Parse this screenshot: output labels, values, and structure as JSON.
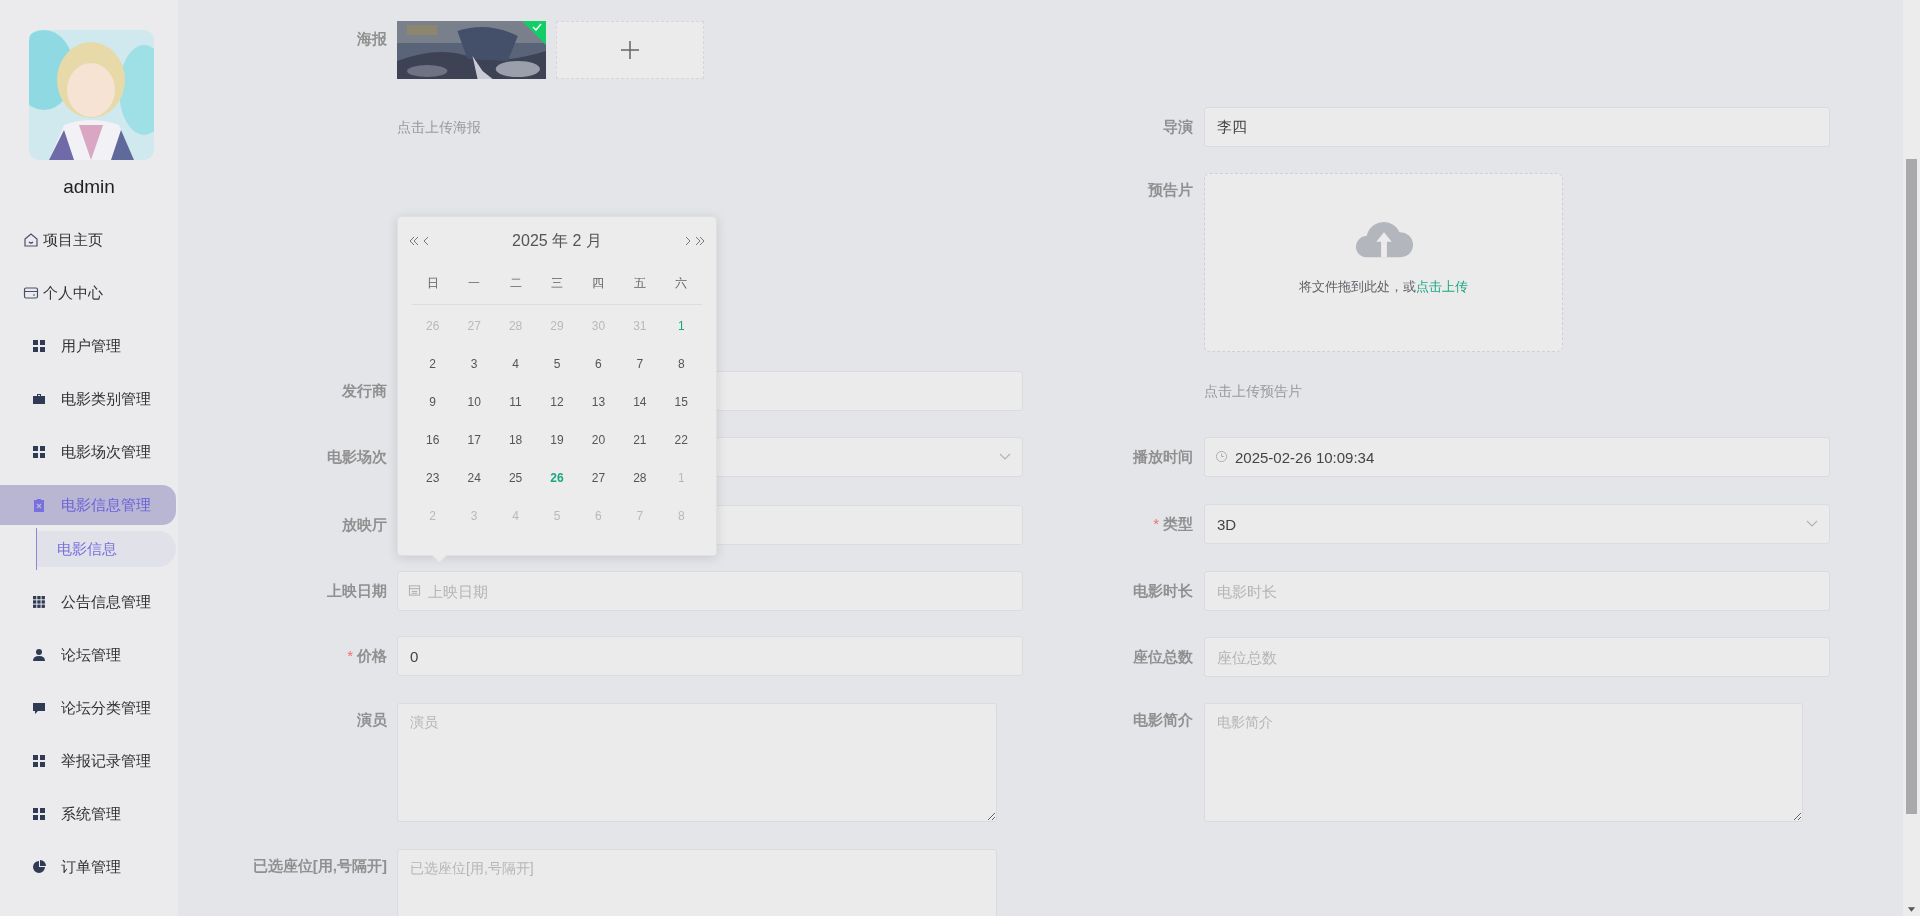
{
  "sidebar": {
    "user": "admin",
    "menu": [
      {
        "label": "项目主页",
        "selected": false
      },
      {
        "label": "个人中心",
        "selected": false
      },
      {
        "label": "用户管理",
        "selected": false
      },
      {
        "label": "电影类别管理",
        "selected": false
      },
      {
        "label": "电影场次管理",
        "selected": false
      },
      {
        "label": "电影信息管理",
        "selected": true,
        "children": [
          {
            "label": "电影信息",
            "selected": true
          }
        ]
      },
      {
        "label": "公告信息管理",
        "selected": false
      },
      {
        "label": "论坛管理",
        "selected": false
      },
      {
        "label": "论坛分类管理",
        "selected": false
      },
      {
        "label": "举报记录管理",
        "selected": false
      },
      {
        "label": "系统管理",
        "selected": false
      },
      {
        "label": "订单管理",
        "selected": false
      }
    ]
  },
  "form": {
    "left": [
      {
        "kind": "poster",
        "label": "海报",
        "files": [
          {
            "kind": "picture",
            "uploaded": true
          }
        ]
      },
      {
        "kind": "tip",
        "text": "点击上传海报"
      },
      {
        "kind": "input",
        "label": "发行商"
      },
      {
        "kind": "select",
        "label": "电影场次"
      },
      {
        "kind": "input",
        "label": "放映厅"
      },
      {
        "kind": "date",
        "label": "上映日期",
        "placeholder": "上映日期"
      },
      {
        "kind": "input",
        "label": "价格",
        "mark": "*",
        "value": "0"
      },
      {
        "kind": "textarea",
        "label": "演员",
        "placeholder": "演员"
      },
      {
        "kind": "textarea",
        "label": "已选座位[用,号隔开]",
        "placeholder": "已选座位[用,号隔开]"
      }
    ],
    "right": [
      {
        "kind": "input",
        "label": "导演",
        "value": "李四"
      },
      {
        "kind": "dragger",
        "label": "预告片",
        "text": "将文件拖到此处，或",
        "link": "点击上传"
      },
      {
        "kind": "tip",
        "text": "点击上传预告片"
      },
      {
        "kind": "datetime",
        "label": "播放时间",
        "value": "2025-02-26 10:09:34"
      },
      {
        "kind": "select",
        "label": "类型",
        "mark": "*",
        "value": "3D"
      },
      {
        "kind": "input",
        "label": "电影时长",
        "placeholder": "电影时长"
      },
      {
        "kind": "input",
        "label": "座位总数",
        "placeholder": "座位总数"
      },
      {
        "kind": "textarea",
        "label": "电影简介",
        "placeholder": "电影简介"
      }
    ]
  },
  "calendar": {
    "title": "2025 年 2 月",
    "weekdays": [
      "日",
      "一",
      "二",
      "三",
      "四",
      "五",
      "六"
    ],
    "weeks": [
      [
        {
          "day": "26",
          "kind": "other"
        },
        {
          "day": "27",
          "kind": "other"
        },
        {
          "day": "28",
          "kind": "other"
        },
        {
          "day": "29",
          "kind": "other"
        },
        {
          "day": "30",
          "kind": "other"
        },
        {
          "day": "31",
          "kind": "other"
        },
        {
          "day": "1",
          "kind": "hover"
        }
      ],
      [
        {
          "day": "2",
          "kind": "current"
        },
        {
          "day": "3",
          "kind": "current"
        },
        {
          "day": "4",
          "kind": "current"
        },
        {
          "day": "5",
          "kind": "current"
        },
        {
          "day": "6",
          "kind": "current"
        },
        {
          "day": "7",
          "kind": "current"
        },
        {
          "day": "8",
          "kind": "current"
        }
      ],
      [
        {
          "day": "9",
          "kind": "current"
        },
        {
          "day": "10",
          "kind": "current"
        },
        {
          "day": "11",
          "kind": "current"
        },
        {
          "day": "12",
          "kind": "current"
        },
        {
          "day": "13",
          "kind": "current"
        },
        {
          "day": "14",
          "kind": "current"
        },
        {
          "day": "15",
          "kind": "current"
        }
      ],
      [
        {
          "day": "16",
          "kind": "current"
        },
        {
          "day": "17",
          "kind": "current"
        },
        {
          "day": "18",
          "kind": "current"
        },
        {
          "day": "19",
          "kind": "current"
        },
        {
          "day": "20",
          "kind": "current"
        },
        {
          "day": "21",
          "kind": "current"
        },
        {
          "day": "22",
          "kind": "current"
        }
      ],
      [
        {
          "day": "23",
          "kind": "current"
        },
        {
          "day": "24",
          "kind": "current"
        },
        {
          "day": "25",
          "kind": "current"
        },
        {
          "day": "26",
          "kind": "today"
        },
        {
          "day": "27",
          "kind": "current"
        },
        {
          "day": "28",
          "kind": "current"
        },
        {
          "day": "1",
          "kind": "other"
        }
      ],
      [
        {
          "day": "2",
          "kind": "other"
        },
        {
          "day": "3",
          "kind": "other"
        },
        {
          "day": "4",
          "kind": "other"
        },
        {
          "day": "5",
          "kind": "other"
        },
        {
          "day": "6",
          "kind": "other"
        },
        {
          "day": "7",
          "kind": "other"
        },
        {
          "day": "8",
          "kind": "other"
        }
      ]
    ]
  }
}
